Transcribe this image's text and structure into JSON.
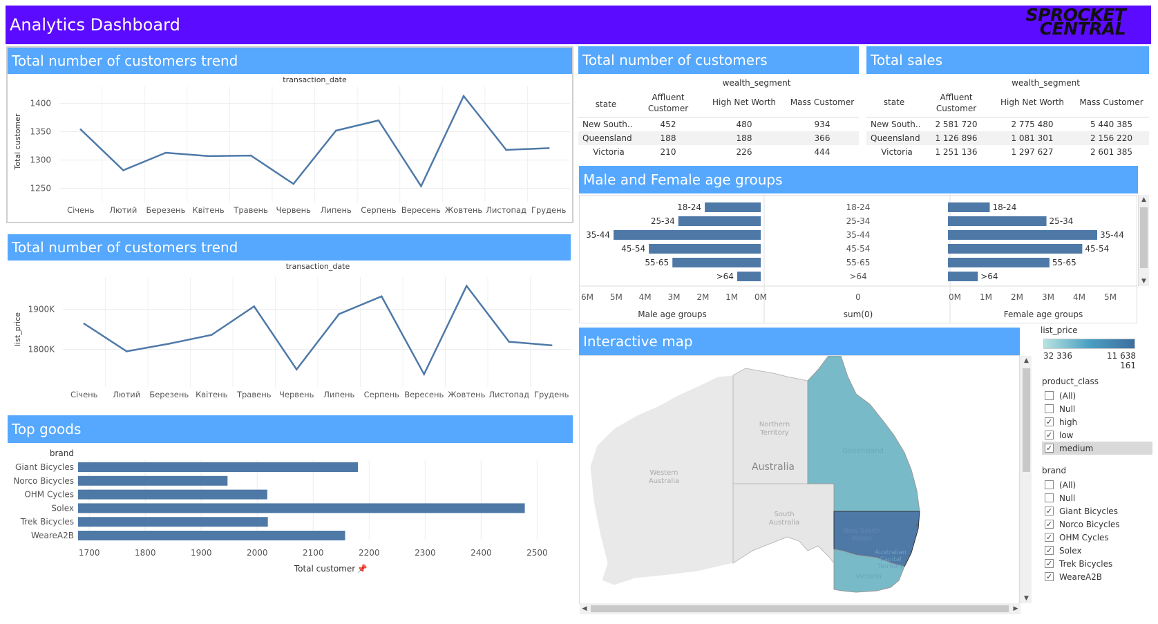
{
  "header": {
    "title": "Analytics Dashboard",
    "logo_line1": "SPROCKET",
    "logo_line2": "CENTRAL"
  },
  "colors": {
    "header": "#5b0bff",
    "panel_header": "#55a8fe",
    "mark": "#4e79a7"
  },
  "trend1": {
    "title": "Total number of customers trend",
    "top_label": "transaction_date",
    "ylabel": "Total customer",
    "chart_data": {
      "type": "line",
      "categories": [
        "Січень",
        "Лютий",
        "Березень",
        "Квітень",
        "Травень",
        "Червень",
        "Липень",
        "Серпень",
        "Вересень",
        "Жовтень",
        "Листопад",
        "Грудень"
      ],
      "values": [
        1354,
        1282,
        1313,
        1307,
        1308,
        1258,
        1352,
        1370,
        1254,
        1413,
        1318,
        1321
      ],
      "yticks": [
        1250,
        1300,
        1350,
        1400
      ],
      "ylim": [
        1235,
        1430
      ]
    }
  },
  "trend2": {
    "title": "Total number of customers trend",
    "top_label": "transaction_date",
    "ylabel": "list_price",
    "chart_data": {
      "type": "line",
      "categories": [
        "Січень",
        "Лютий",
        "Березень",
        "Квітень",
        "Травень",
        "Червень",
        "Липень",
        "Серпень",
        "Вересень",
        "Жовтень",
        "Листопад",
        "Грудень"
      ],
      "values": [
        1864000,
        1795000,
        1814000,
        1836000,
        1907000,
        1750000,
        1888000,
        1932000,
        1738000,
        1958000,
        1819000,
        1810000
      ],
      "yticks": [
        1800000,
        1900000
      ],
      "ytick_labels": [
        "1800K",
        "1900K"
      ],
      "ylim": [
        1720000,
        1980000
      ]
    }
  },
  "top_goods": {
    "title": "Top goods",
    "axis_title": "brand",
    "xlabel": "Total customer",
    "chart_data": {
      "type": "bar",
      "categories": [
        "Giant Bicycles",
        "Norco Bicycles",
        "OHM Cycles",
        "Solex",
        "Trek Bicycles",
        "WeareA2B"
      ],
      "values": [
        2180,
        1947,
        2018,
        2478,
        2019,
        2157
      ],
      "xticks": [
        1700,
        1800,
        1900,
        2000,
        2100,
        2200,
        2300,
        2400,
        2500
      ],
      "xlim": [
        1680,
        2560
      ]
    }
  },
  "customers_table": {
    "title": "Total number of customers",
    "group_label": "wealth_segment",
    "columns": [
      "state",
      "Affluent Customer",
      "High Net Worth",
      "Mass Customer"
    ],
    "rows": [
      [
        "New South..",
        "452",
        "480",
        "934"
      ],
      [
        "Queensland",
        "188",
        "188",
        "366"
      ],
      [
        "Victoria",
        "210",
        "226",
        "444"
      ]
    ]
  },
  "sales_table": {
    "title": "Total sales",
    "group_label": "wealth_segment",
    "columns": [
      "state",
      "Affluent Customer",
      "High Net Worth",
      "Mass Customer"
    ],
    "rows": [
      [
        "New South..",
        "2 581 720",
        "2 775 480",
        "5 440 385"
      ],
      [
        "Queensland",
        "1 126 896",
        "1 081 301",
        "2 156 220"
      ],
      [
        "Victoria",
        "1 251 136",
        "1 297 627",
        "2 601 385"
      ]
    ]
  },
  "age_groups": {
    "title": "Male and Female age groups",
    "male_label": "Male age groups",
    "center_label": "sum(0)",
    "female_label": "Female age groups",
    "categories": [
      "18-24",
      "25-34",
      "35-44",
      "45-54",
      "55-65",
      ">64"
    ],
    "male_values": [
      1.9,
      2.8,
      5.0,
      3.8,
      3.0,
      0.8
    ],
    "female_values": [
      1.4,
      3.3,
      5.0,
      4.5,
      3.4,
      1.0
    ],
    "male_ticks": [
      "6M",
      "5M",
      "4M",
      "3M",
      "2M",
      "1M",
      "0M"
    ],
    "center_tick": "0",
    "female_ticks": [
      "0M",
      "1M",
      "2M",
      "3M",
      "4M",
      "5M"
    ]
  },
  "map": {
    "title": "Interactive map",
    "labels": {
      "nt": "Northern Territory",
      "wa": "Western Australia",
      "australia": "Australia",
      "sa": "South Australia",
      "qld": "Queensland",
      "nsw": "New South Wales",
      "act": "Australian Capital Territory",
      "vic": "Victoria"
    }
  },
  "legend": {
    "title": "list_price",
    "min": "32 336",
    "max": "11 638 161"
  },
  "product_class_filter": {
    "title": "product_class",
    "items": [
      {
        "label": "(All)",
        "checked": false
      },
      {
        "label": "Null",
        "checked": false
      },
      {
        "label": "high",
        "checked": true
      },
      {
        "label": "low",
        "checked": true
      },
      {
        "label": "medium",
        "checked": true
      }
    ]
  },
  "brand_filter": {
    "title": "brand",
    "items": [
      {
        "label": "(All)",
        "checked": false
      },
      {
        "label": "Null",
        "checked": false
      },
      {
        "label": "Giant Bicycles",
        "checked": true
      },
      {
        "label": "Norco Bicycles",
        "checked": true
      },
      {
        "label": "OHM Cycles",
        "checked": true
      },
      {
        "label": "Solex",
        "checked": true
      },
      {
        "label": "Trek Bicycles",
        "checked": true
      },
      {
        "label": "WeareA2B",
        "checked": true
      }
    ]
  }
}
